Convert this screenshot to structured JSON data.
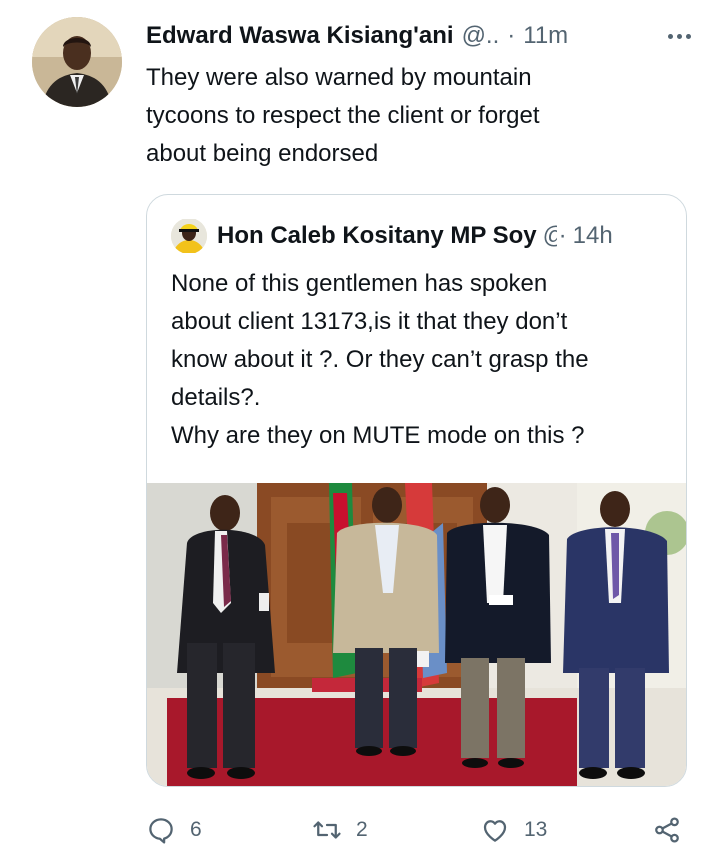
{
  "tweet": {
    "author_name": "Edward Waswa Kisiang'ani",
    "author_handle": "@..",
    "dot": "·",
    "time": "11m",
    "text_lines": [
      "They were also warned by mountain",
      "tycoons to respect the client or forget",
      "about being endorsed"
    ]
  },
  "quote": {
    "author_name": "Hon Caleb Kositany MP Soy",
    "author_handle": "@",
    "dot": "·",
    "time": "14h",
    "text_lines": [
      "None of this gentlemen has spoken",
      "about client 13173,is it that they don’t",
      "know about it ?. Or they can’t grasp the",
      "details?.",
      "Why are they on MUTE mode on this ?"
    ]
  },
  "actions": {
    "reply_count": "6",
    "retweet_count": "2",
    "like_count": "13"
  },
  "icons": {
    "more": "more-horizontal-icon",
    "reply": "reply-icon",
    "retweet": "retweet-icon",
    "like": "heart-icon",
    "share": "share-icon"
  },
  "colors": {
    "text_primary": "#0f1419",
    "text_secondary": "#536471",
    "border": "#cfd9de",
    "carpet": "#b0192b"
  }
}
